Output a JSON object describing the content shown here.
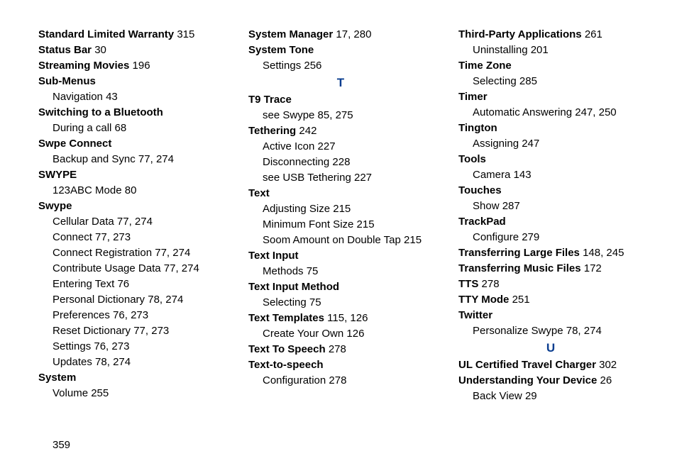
{
  "pageNumber": "359",
  "col1": [
    {
      "k": "bnum",
      "label": "Standard Limited Warranty",
      "pages": "315"
    },
    {
      "k": "bnum",
      "label": "Status Bar",
      "pages": "30"
    },
    {
      "k": "bnum",
      "label": "Streaming Movies",
      "pages": "196"
    },
    {
      "k": "bold",
      "label": "Sub-Menus"
    },
    {
      "k": "sub",
      "label": "Navigation",
      "pages": "43"
    },
    {
      "k": "bold",
      "label": "Switching to a Bluetooth"
    },
    {
      "k": "sub",
      "label": "During a call",
      "pages": "68"
    },
    {
      "k": "bold",
      "label": "Swpe Connect"
    },
    {
      "k": "sub",
      "label": "Backup and Sync",
      "pages": "77, 274"
    },
    {
      "k": "bold",
      "label": "SWYPE"
    },
    {
      "k": "sub",
      "label": "123ABC Mode",
      "pages": "80"
    },
    {
      "k": "bold",
      "label": "Swype"
    },
    {
      "k": "sub",
      "label": "Cellular Data",
      "pages": "77, 274"
    },
    {
      "k": "sub",
      "label": "Connect",
      "pages": "77, 273"
    },
    {
      "k": "sub",
      "label": "Connect Registration",
      "pages": "77, 274"
    },
    {
      "k": "sub",
      "label": "Contribute Usage Data",
      "pages": "77, 274"
    },
    {
      "k": "sub",
      "label": "Entering Text",
      "pages": "76"
    },
    {
      "k": "sub",
      "label": "Personal Dictionary",
      "pages": "78, 274"
    },
    {
      "k": "sub",
      "label": "Preferences",
      "pages": "76, 273"
    },
    {
      "k": "sub",
      "label": "Reset Dictionary",
      "pages": "77, 273"
    },
    {
      "k": "sub",
      "label": "Settings",
      "pages": "76, 273"
    },
    {
      "k": "sub",
      "label": "Updates",
      "pages": "78, 274"
    },
    {
      "k": "bold",
      "label": "System"
    },
    {
      "k": "sub",
      "label": "Volume",
      "pages": "255"
    }
  ],
  "col2": [
    {
      "k": "bnum",
      "label": "System Manager",
      "pages": "17, 280"
    },
    {
      "k": "bold",
      "label": "System Tone"
    },
    {
      "k": "sub",
      "label": "Settings",
      "pages": "256"
    },
    {
      "k": "letter",
      "label": "T"
    },
    {
      "k": "bold",
      "label": "T9 Trace"
    },
    {
      "k": "sub",
      "label": "see Swype",
      "pages": "85, 275"
    },
    {
      "k": "bnum",
      "label": "Tethering",
      "pages": "242"
    },
    {
      "k": "sub",
      "label": "Active Icon",
      "pages": "227"
    },
    {
      "k": "sub",
      "label": "Disconnecting",
      "pages": "228"
    },
    {
      "k": "sub",
      "label": "see USB Tethering",
      "pages": "227"
    },
    {
      "k": "bold",
      "label": "Text"
    },
    {
      "k": "sub",
      "label": "Adjusting Size",
      "pages": "215"
    },
    {
      "k": "sub",
      "label": "Minimum Font Size",
      "pages": "215"
    },
    {
      "k": "sub",
      "label": "Soom Amount on Double Tap",
      "pages": "215"
    },
    {
      "k": "bold",
      "label": "Text Input"
    },
    {
      "k": "sub",
      "label": "Methods",
      "pages": "75"
    },
    {
      "k": "bold",
      "label": "Text Input Method"
    },
    {
      "k": "sub",
      "label": "Selecting",
      "pages": "75"
    },
    {
      "k": "bnum",
      "label": "Text Templates",
      "pages": "115, 126"
    },
    {
      "k": "sub",
      "label": "Create Your Own",
      "pages": "126"
    },
    {
      "k": "bnum",
      "label": "Text To Speech",
      "pages": "278"
    },
    {
      "k": "bold",
      "label": "Text-to-speech"
    },
    {
      "k": "sub",
      "label": "Configuration",
      "pages": "278"
    }
  ],
  "col3": [
    {
      "k": "bnum",
      "label": "Third-Party Applications",
      "pages": "261"
    },
    {
      "k": "sub",
      "label": "Uninstalling",
      "pages": "201"
    },
    {
      "k": "bold",
      "label": "Time Zone"
    },
    {
      "k": "sub",
      "label": "Selecting",
      "pages": "285"
    },
    {
      "k": "bold",
      "label": "Timer"
    },
    {
      "k": "sub",
      "label": "Automatic Answering",
      "pages": "247, 250"
    },
    {
      "k": "bold",
      "label": "Tington"
    },
    {
      "k": "sub",
      "label": "Assigning",
      "pages": "247"
    },
    {
      "k": "bold",
      "label": "Tools"
    },
    {
      "k": "sub",
      "label": "Camera",
      "pages": "143"
    },
    {
      "k": "bold",
      "label": "Touches"
    },
    {
      "k": "sub",
      "label": "Show",
      "pages": "287"
    },
    {
      "k": "bold",
      "label": "TrackPad"
    },
    {
      "k": "sub",
      "label": "Configure",
      "pages": "279"
    },
    {
      "k": "bnum",
      "label": "Transferring Large Files",
      "pages": "148, 245"
    },
    {
      "k": "bnum",
      "label": "Transferring Music Files",
      "pages": "172"
    },
    {
      "k": "bnum",
      "label": "TTS",
      "pages": "278"
    },
    {
      "k": "bnum",
      "label": "TTY Mode",
      "pages": "251"
    },
    {
      "k": "bold",
      "label": "Twitter"
    },
    {
      "k": "sub",
      "label": "Personalize Swype",
      "pages": "78, 274"
    },
    {
      "k": "letter",
      "label": "U"
    },
    {
      "k": "bnum",
      "label": "UL Certified Travel Charger",
      "pages": "302"
    },
    {
      "k": "bnum",
      "label": "Understanding Your Device",
      "pages": "26"
    },
    {
      "k": "sub",
      "label": "Back View",
      "pages": "29"
    }
  ]
}
